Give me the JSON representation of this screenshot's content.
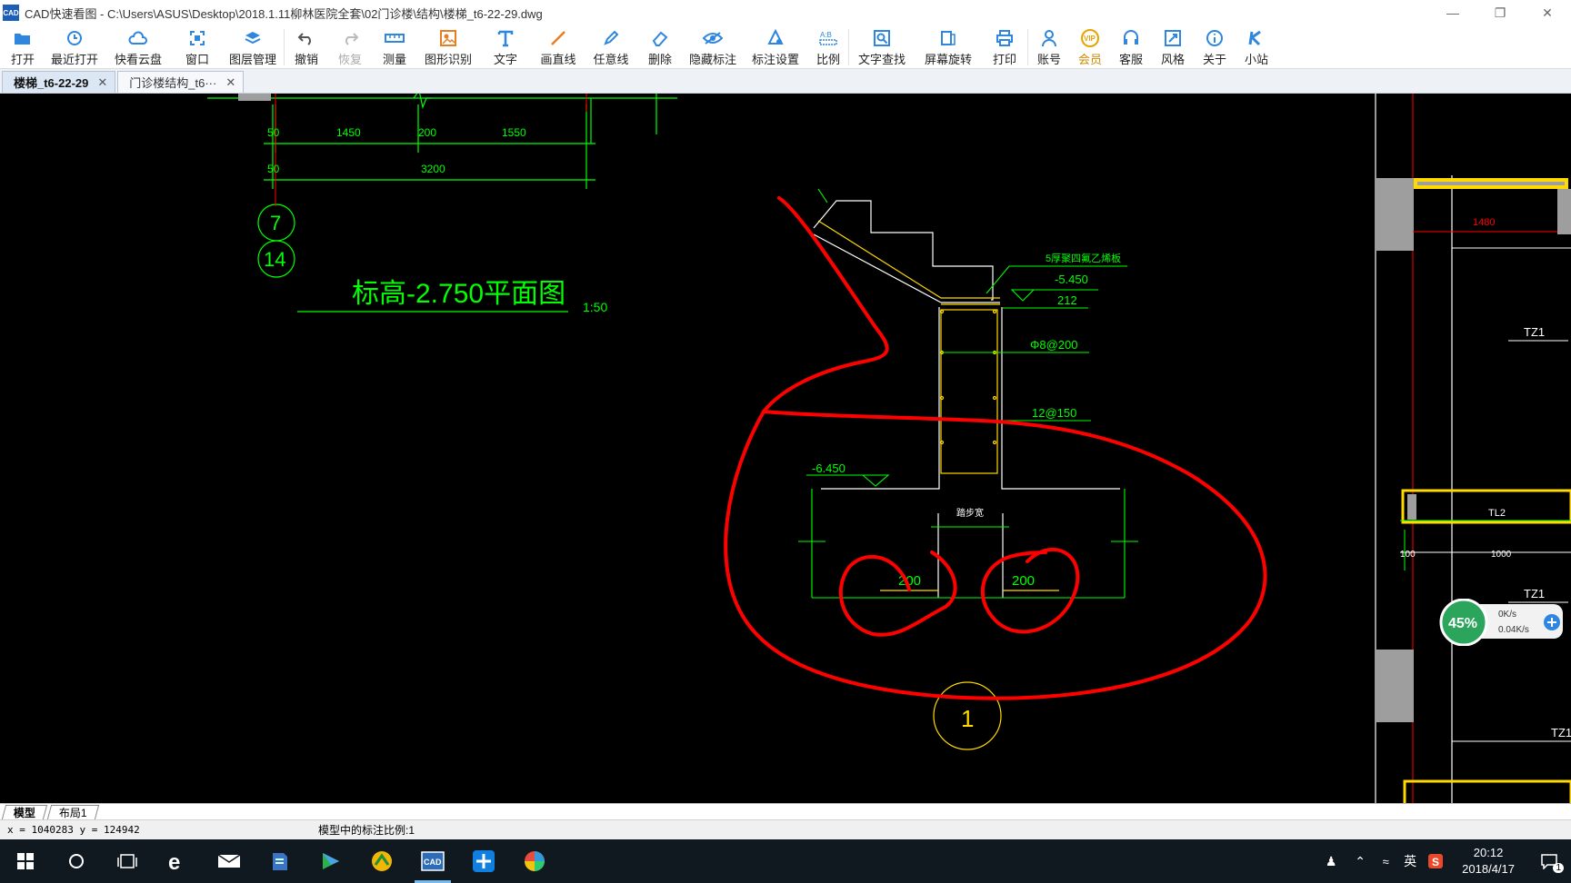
{
  "window": {
    "title": "CAD快速看图 - C:\\Users\\ASUS\\Desktop\\2018.1.11柳林医院全套\\02门诊楼\\结构\\楼梯_t6-22-29.dwg",
    "logo_text": "CAD"
  },
  "toolbar": {
    "items": [
      {
        "label": "打开",
        "icon": "folder-open-icon"
      },
      {
        "label": "最近打开",
        "icon": "clock-icon"
      },
      {
        "label": "快看云盘",
        "icon": "cloud-icon"
      },
      {
        "label": "窗口",
        "icon": "window-icon"
      },
      {
        "label": "图层管理",
        "icon": "layers-icon"
      },
      {
        "label": "撤销",
        "icon": "undo-icon"
      },
      {
        "label": "恢复",
        "icon": "redo-icon"
      },
      {
        "label": "测量",
        "icon": "ruler-icon"
      },
      {
        "label": "图形识别",
        "icon": "shape-recognize-icon"
      },
      {
        "label": "文字",
        "icon": "text-icon"
      },
      {
        "label": "画直线",
        "icon": "line-icon"
      },
      {
        "label": "任意线",
        "icon": "pen-icon"
      },
      {
        "label": "删除",
        "icon": "eraser-icon"
      },
      {
        "label": "隐藏标注",
        "icon": "eye-icon"
      },
      {
        "label": "标注设置",
        "icon": "annotation-settings-icon"
      },
      {
        "label": "比例",
        "icon": "scale-icon"
      },
      {
        "label": "文字查找",
        "icon": "text-search-icon"
      },
      {
        "label": "屏幕旋转",
        "icon": "rotate-icon"
      },
      {
        "label": "打印",
        "icon": "printer-icon"
      },
      {
        "label": "账号",
        "icon": "user-icon"
      },
      {
        "label": "会员",
        "icon": "vip-icon"
      },
      {
        "label": "客服",
        "icon": "headset-icon"
      },
      {
        "label": "风格",
        "icon": "style-icon"
      },
      {
        "label": "关于",
        "icon": "info-icon"
      },
      {
        "label": "小站",
        "icon": "k-logo-icon"
      }
    ]
  },
  "tabs": [
    {
      "label": "楼梯_t6-22-29",
      "active": true
    },
    {
      "label": "门诊楼结构_t6···",
      "active": false
    }
  ],
  "drawing": {
    "dims_top": [
      "50",
      "1450",
      "200",
      "1550"
    ],
    "dims_total": [
      "50",
      "3200"
    ],
    "axis_labels": [
      "7",
      "14"
    ],
    "plan_title": "标高-2.750平面图",
    "plan_scale": "1:50",
    "callout_note": "5厚聚四氟乙烯板",
    "elev_top": "-5.450",
    "dim_212": "212",
    "rebar_stirrup": "Φ8@200",
    "rebar_main": "12@150",
    "elev_bottom": "-6.450",
    "footing_label": "踏步宽",
    "dim_left": "200",
    "dim_right": "200",
    "bottom_axis": "1",
    "right_dim_1480": "1480",
    "right_tz1_a": "TZ1",
    "right_tz1_b": "TZ1",
    "right_tz1_c": "TZ1",
    "right_tl2": "TL2",
    "right_dim_100": "100",
    "right_dim_1000": "1000"
  },
  "net_widget": {
    "percent": "45%",
    "up": "0K/s",
    "down": "0.04K/s"
  },
  "layout_tabs": [
    "模型",
    "布局1"
  ],
  "status": {
    "coords": "x = 1040283  y = 124942",
    "scale_text": "模型中的标注比例:1"
  },
  "taskbar": {
    "time": "20:12",
    "date": "2018/4/17",
    "ime": "英",
    "notif_count": "1"
  },
  "colors": {
    "cad_green": "#00ff00",
    "cad_yellow": "#ffd900",
    "markup_red": "#ff0000",
    "canvas_bg": "#000000"
  }
}
